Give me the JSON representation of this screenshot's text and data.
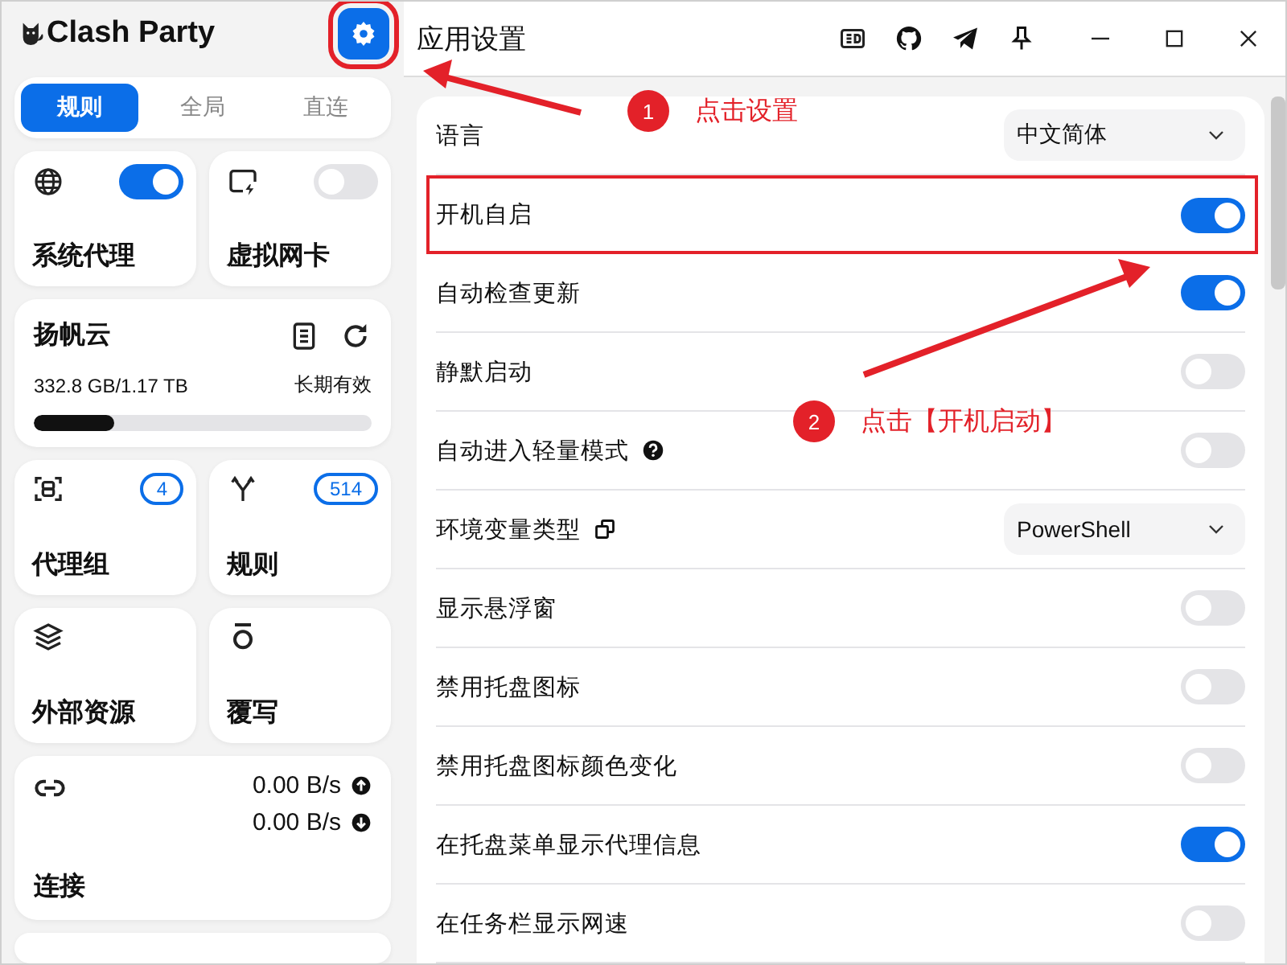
{
  "app": {
    "name": "Clash Party",
    "settings_highlighted": true
  },
  "modes": [
    {
      "label": "规则",
      "selected": true
    },
    {
      "label": "全局",
      "selected": false
    },
    {
      "label": "直连",
      "selected": false
    }
  ],
  "switch_cards": [
    {
      "label": "系统代理",
      "on": true,
      "kind": "globe"
    },
    {
      "label": "虚拟网卡",
      "on": false,
      "kind": "tun"
    }
  ],
  "profile": {
    "name": "扬帆云",
    "usage": "332.8 GB/1.17 TB",
    "expiry": "长期有效",
    "level": 0.24
  },
  "nav_cards": [
    {
      "label": "代理组",
      "count": "4",
      "kind": "groups"
    },
    {
      "label": "规则",
      "count": "514",
      "kind": "rules"
    },
    {
      "label": "外部资源",
      "kind": "resources"
    },
    {
      "label": "覆写",
      "kind": "override"
    }
  ],
  "connections": {
    "label": "连接",
    "upload": "0.00 B/s",
    "download": "0.00 B/s"
  },
  "page": {
    "title": "应用设置"
  },
  "settings": [
    {
      "label": "语言",
      "kind": "select",
      "value": "中文简体",
      "highlighted": false
    },
    {
      "label": "开机自启",
      "kind": "toggle",
      "on": true,
      "highlighted": true
    },
    {
      "label": "自动检查更新",
      "kind": "toggle",
      "on": true,
      "highlighted": false
    },
    {
      "label": "静默启动",
      "kind": "toggle",
      "on": false,
      "highlighted": false
    },
    {
      "label": "自动进入轻量模式",
      "kind": "helptoggle",
      "on": false,
      "highlighted": false
    },
    {
      "label": "环境变量类型",
      "kind": "copyselect",
      "value": "PowerShell",
      "highlighted": false
    },
    {
      "label": "显示悬浮窗",
      "kind": "toggle",
      "on": false,
      "highlighted": false
    },
    {
      "label": "禁用托盘图标",
      "kind": "toggle",
      "on": false,
      "highlighted": false
    },
    {
      "label": "禁用托盘图标颜色变化",
      "kind": "toggle",
      "on": false,
      "highlighted": false
    },
    {
      "label": "在托盘菜单显示代理信息",
      "kind": "toggle",
      "on": true,
      "highlighted": false
    },
    {
      "label": "在任务栏显示网速",
      "kind": "toggle",
      "on": false,
      "highlighted": false
    }
  ],
  "annotations": [
    {
      "number": "1",
      "text": "点击设置"
    },
    {
      "number": "2",
      "text": "点击【开机启动】"
    }
  ]
}
